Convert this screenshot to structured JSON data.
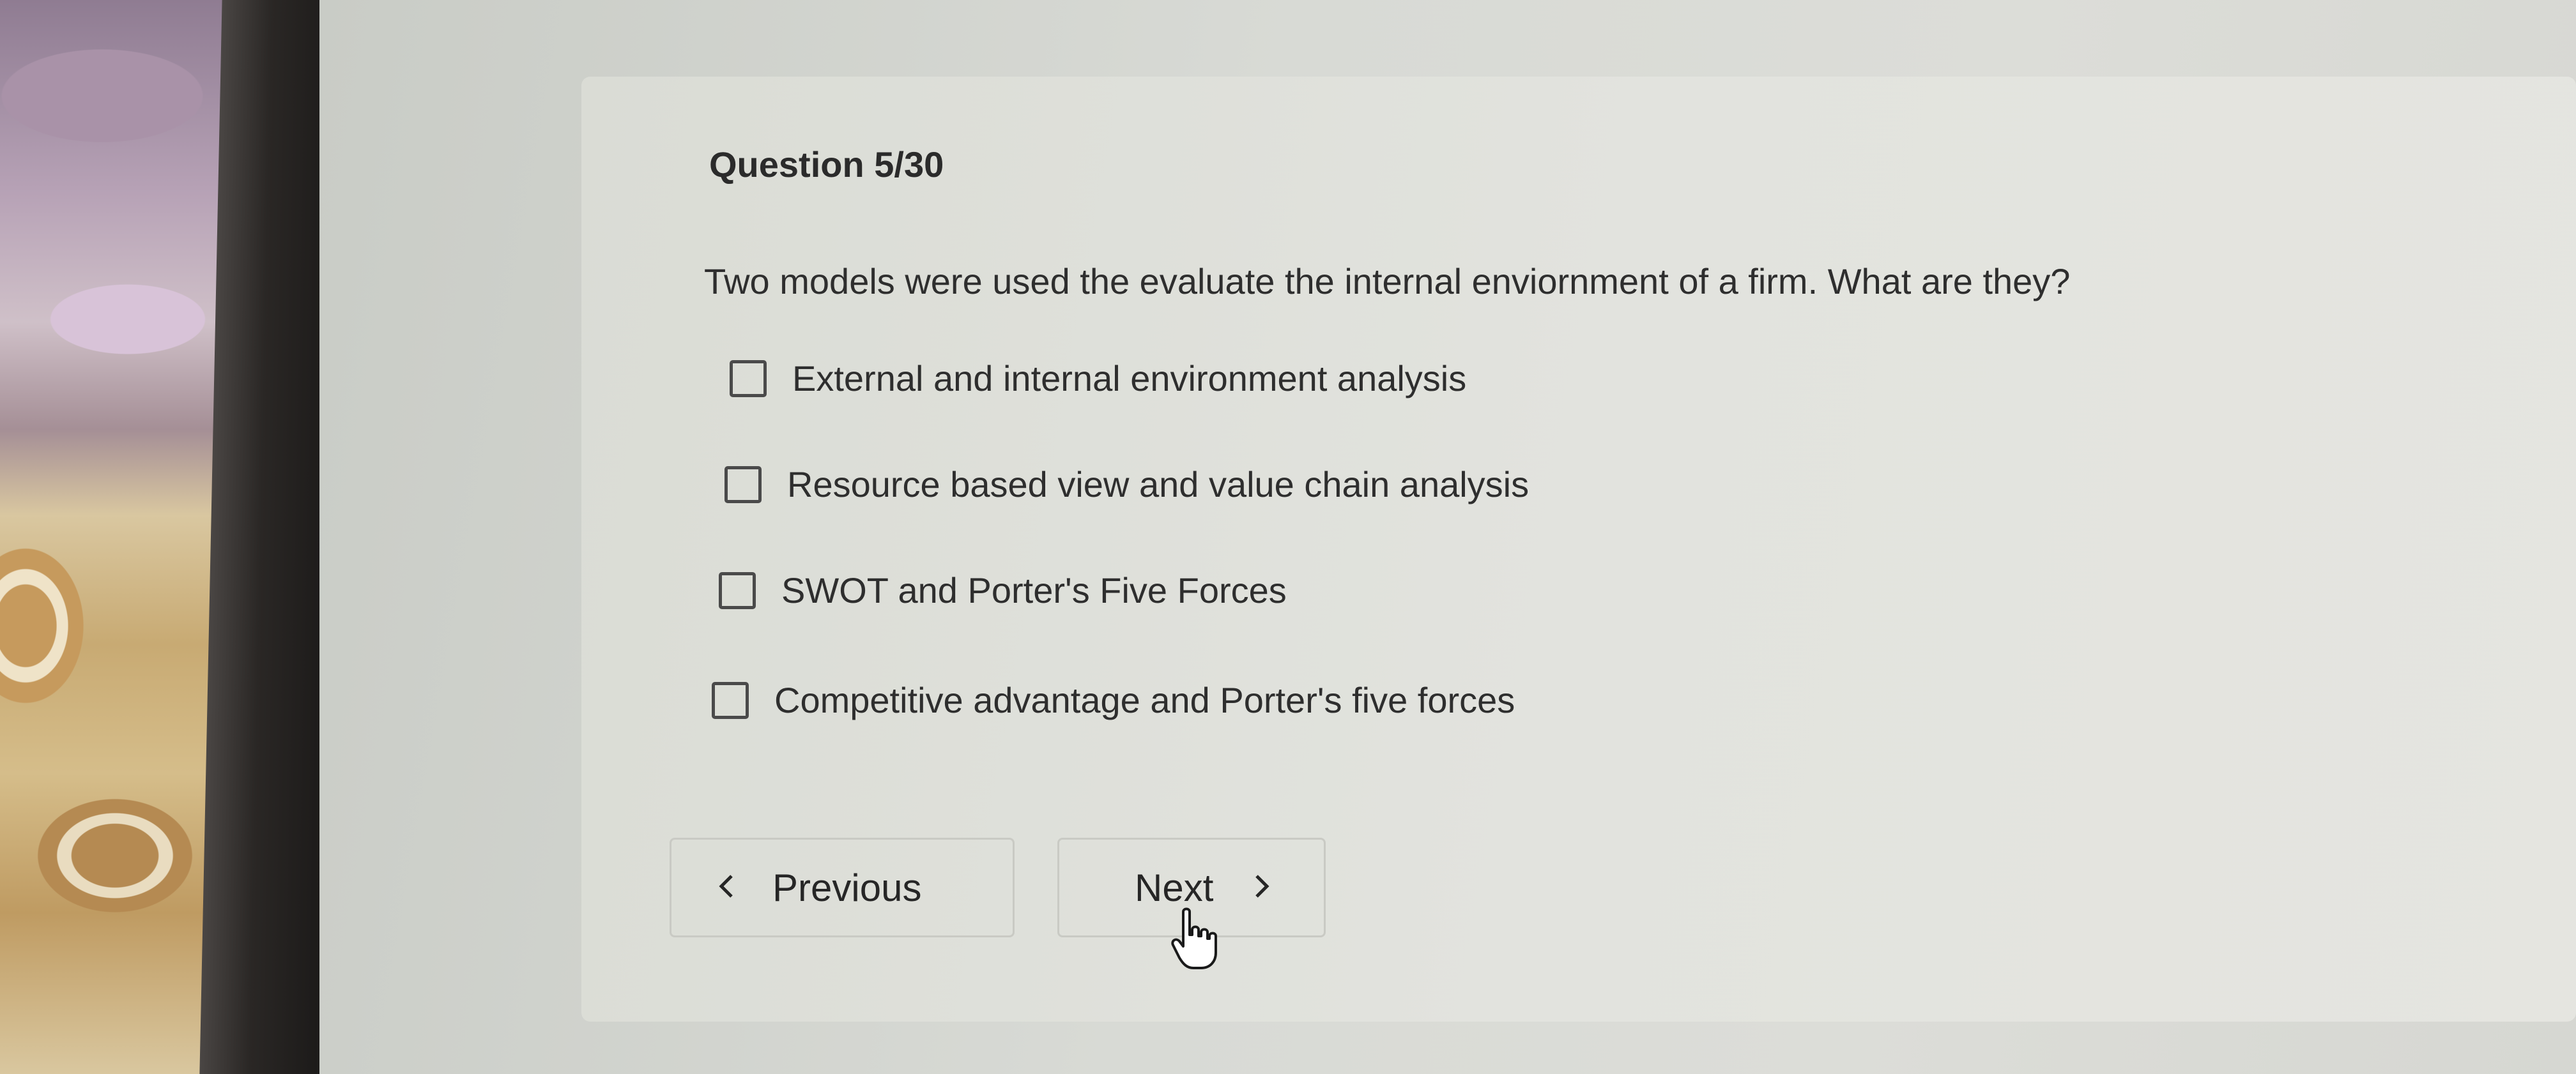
{
  "quiz": {
    "question_counter": "Question 5/30",
    "question_text": "Two models were used the evaluate the internal enviornment of a firm. What are they?",
    "options": [
      {
        "label": "External and internal environment analysis",
        "checked": false
      },
      {
        "label": "Resource based view and value chain analysis",
        "checked": false
      },
      {
        "label": "SWOT and Porter's Five Forces",
        "checked": false
      },
      {
        "label": "Competitive advantage and Porter's five forces",
        "checked": false
      }
    ]
  },
  "navigation": {
    "previous_label": "Previous",
    "previous_icon": "chevron-left-icon",
    "next_label": "Next",
    "next_icon": "chevron-right-icon"
  },
  "pointer": {
    "icon": "hand-pointer-icon"
  }
}
